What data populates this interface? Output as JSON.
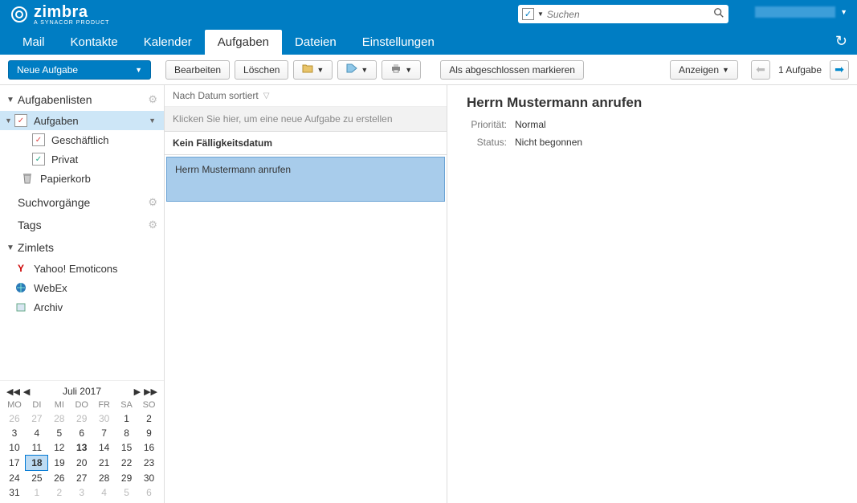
{
  "brand": {
    "name": "zimbra",
    "tagline": "A SYNACOR PRODUCT"
  },
  "search": {
    "placeholder": "Suchen"
  },
  "tabs": [
    "Mail",
    "Kontakte",
    "Kalender",
    "Aufgaben",
    "Dateien",
    "Einstellungen"
  ],
  "activeTab": 3,
  "toolbar": {
    "newTask": "Neue Aufgabe",
    "edit": "Bearbeiten",
    "delete": "Löschen",
    "markComplete": "Als abgeschlossen markieren",
    "show": "Anzeigen",
    "count": "1 Aufgabe"
  },
  "sidebar": {
    "listsHead": "Aufgabenlisten",
    "lists": [
      "Aufgaben",
      "Geschäftlich",
      "Privat"
    ],
    "trash": "Papierkorb",
    "searches": "Suchvorgänge",
    "tags": "Tags",
    "zimletsHead": "Zimlets",
    "zimlets": [
      "Yahoo! Emoticons",
      "WebEx",
      "Archiv"
    ]
  },
  "calendar": {
    "title": "Juli 2017",
    "dows": [
      "MO",
      "DI",
      "MI",
      "DO",
      "FR",
      "SA",
      "SO"
    ],
    "weeks": [
      [
        {
          "d": 26,
          "m": 1
        },
        {
          "d": 27,
          "m": 1
        },
        {
          "d": 28,
          "m": 1
        },
        {
          "d": 29,
          "m": 1
        },
        {
          "d": 30,
          "m": 1
        },
        {
          "d": 1
        },
        {
          "d": 2
        }
      ],
      [
        {
          "d": 3
        },
        {
          "d": 4
        },
        {
          "d": 5
        },
        {
          "d": 6
        },
        {
          "d": 7
        },
        {
          "d": 8
        },
        {
          "d": 9
        }
      ],
      [
        {
          "d": 10
        },
        {
          "d": 11
        },
        {
          "d": 12
        },
        {
          "d": 13,
          "b": 1
        },
        {
          "d": 14
        },
        {
          "d": 15
        },
        {
          "d": 16
        }
      ],
      [
        {
          "d": 17
        },
        {
          "d": 18,
          "t": 1
        },
        {
          "d": 19
        },
        {
          "d": 20
        },
        {
          "d": 21
        },
        {
          "d": 22
        },
        {
          "d": 23
        }
      ],
      [
        {
          "d": 24
        },
        {
          "d": 25
        },
        {
          "d": 26
        },
        {
          "d": 27
        },
        {
          "d": 28
        },
        {
          "d": 29
        },
        {
          "d": 30
        }
      ],
      [
        {
          "d": 31
        },
        {
          "d": 1,
          "m": 1
        },
        {
          "d": 2,
          "m": 1
        },
        {
          "d": 3,
          "m": 1
        },
        {
          "d": 4,
          "m": 1
        },
        {
          "d": 5,
          "m": 1
        },
        {
          "d": 6,
          "m": 1
        }
      ]
    ]
  },
  "listPane": {
    "sort": "Nach Datum sortiert",
    "newHint": "Klicken Sie hier, um eine neue Aufgabe zu erstellen",
    "group": "Kein Fälligkeitsdatum",
    "task": "Herrn Mustermann anrufen"
  },
  "detail": {
    "title": "Herrn Mustermann anrufen",
    "priorityLabel": "Priorität:",
    "priority": "Normal",
    "statusLabel": "Status:",
    "status": "Nicht begonnen"
  }
}
